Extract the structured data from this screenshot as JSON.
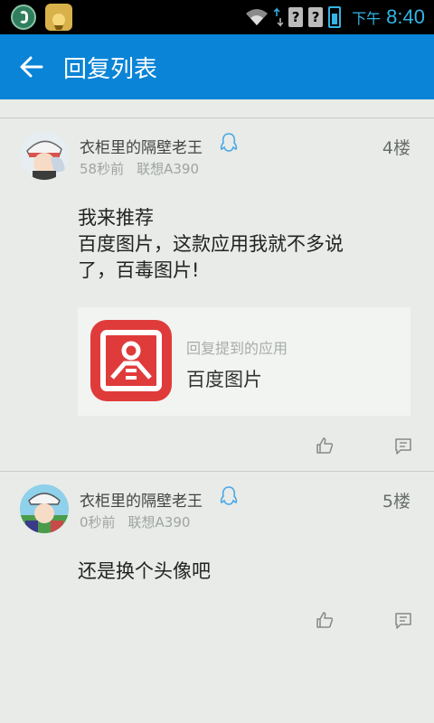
{
  "status_bar": {
    "time_prefix": "下午",
    "time": "8:40"
  },
  "header": {
    "title": "回复列表",
    "back_icon": "arrow-left-icon"
  },
  "replies": [
    {
      "username": "衣柜里的隔壁老王",
      "time_ago": "58秒前",
      "device": "联想A390",
      "floor": "4楼",
      "content_lines": [
        "我来推荐",
        "百度图片，这款应用我就不多说",
        "了，百毒图片!"
      ],
      "app_card": {
        "hint": "回复提到的应用",
        "name": "百度图片",
        "icon_color": "#e03b3b"
      }
    },
    {
      "username": "衣柜里的隔壁老王",
      "time_ago": "0秒前",
      "device": "联想A390",
      "floor": "5楼",
      "content_lines": [
        "还是换个头像吧"
      ]
    }
  ],
  "colors": {
    "action_bar": "#0a84d6",
    "background": "#e8ebe8",
    "status_accent": "#33b5e5",
    "qq_blue": "#4aa8e8"
  }
}
